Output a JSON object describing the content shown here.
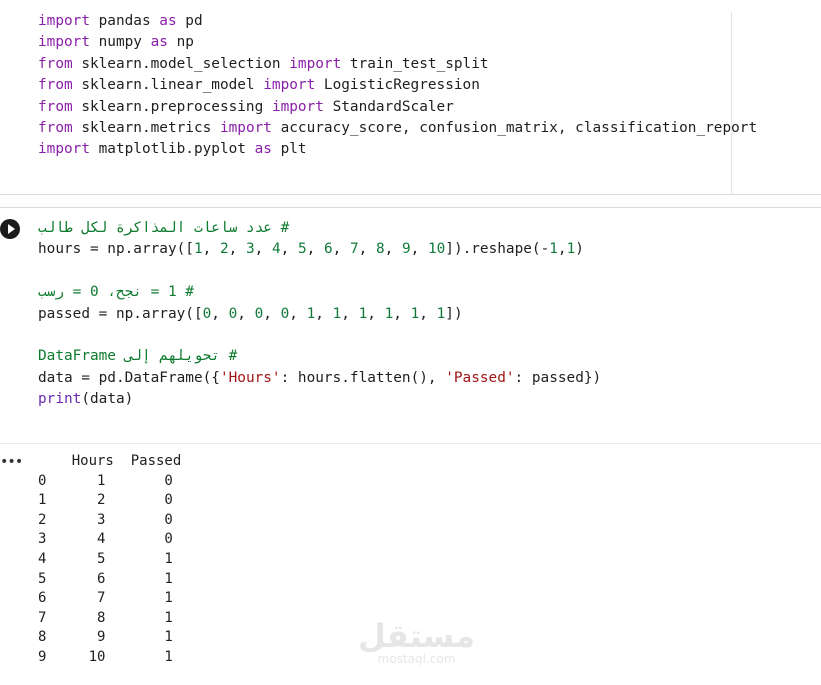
{
  "cell1": {
    "lines": [
      [
        [
          "kw",
          "import"
        ],
        [
          "plain",
          " pandas "
        ],
        [
          "kw",
          "as"
        ],
        [
          "plain",
          " pd"
        ]
      ],
      [
        [
          "kw",
          "import"
        ],
        [
          "plain",
          " numpy "
        ],
        [
          "kw",
          "as"
        ],
        [
          "plain",
          " np"
        ]
      ],
      [
        [
          "kw",
          "from"
        ],
        [
          "plain",
          " sklearn.model_selection "
        ],
        [
          "kw",
          "import"
        ],
        [
          "plain",
          " train_test_split"
        ]
      ],
      [
        [
          "kw",
          "from"
        ],
        [
          "plain",
          " sklearn.linear_model "
        ],
        [
          "kw",
          "import"
        ],
        [
          "plain",
          " LogisticRegression"
        ]
      ],
      [
        [
          "kw",
          "from"
        ],
        [
          "plain",
          " sklearn.preprocessing "
        ],
        [
          "kw",
          "import"
        ],
        [
          "plain",
          " StandardScaler"
        ]
      ],
      [
        [
          "kw",
          "from"
        ],
        [
          "plain",
          " sklearn.metrics "
        ],
        [
          "kw",
          "import"
        ],
        [
          "plain",
          " accuracy_score, confusion_matrix, classification_report"
        ]
      ],
      [
        [
          "kw",
          "import"
        ],
        [
          "plain",
          " matplotlib.pyplot "
        ],
        [
          "kw",
          "as"
        ],
        [
          "plain",
          " plt"
        ]
      ]
    ]
  },
  "cell2": {
    "lines": [
      [
        [
          "com",
          "# عدد ساعات المذاكرة لكل طالب"
        ]
      ],
      [
        [
          "plain",
          "hours = np.array(["
        ],
        [
          "num",
          "1"
        ],
        [
          "plain",
          ", "
        ],
        [
          "num",
          "2"
        ],
        [
          "plain",
          ", "
        ],
        [
          "num",
          "3"
        ],
        [
          "plain",
          ", "
        ],
        [
          "num",
          "4"
        ],
        [
          "plain",
          ", "
        ],
        [
          "num",
          "5"
        ],
        [
          "plain",
          ", "
        ],
        [
          "num",
          "6"
        ],
        [
          "plain",
          ", "
        ],
        [
          "num",
          "7"
        ],
        [
          "plain",
          ", "
        ],
        [
          "num",
          "8"
        ],
        [
          "plain",
          ", "
        ],
        [
          "num",
          "9"
        ],
        [
          "plain",
          ", "
        ],
        [
          "num",
          "10"
        ],
        [
          "plain",
          "]).reshape(-"
        ],
        [
          "num",
          "1"
        ],
        [
          "plain",
          ","
        ],
        [
          "num",
          "1"
        ],
        [
          "plain",
          ")"
        ]
      ],
      [],
      [
        [
          "com",
          "# 1 = نجح، 0 = رسب"
        ]
      ],
      [
        [
          "plain",
          "passed = np.array(["
        ],
        [
          "num",
          "0"
        ],
        [
          "plain",
          ", "
        ],
        [
          "num",
          "0"
        ],
        [
          "plain",
          ", "
        ],
        [
          "num",
          "0"
        ],
        [
          "plain",
          ", "
        ],
        [
          "num",
          "0"
        ],
        [
          "plain",
          ", "
        ],
        [
          "num",
          "1"
        ],
        [
          "plain",
          ", "
        ],
        [
          "num",
          "1"
        ],
        [
          "plain",
          ", "
        ],
        [
          "num",
          "1"
        ],
        [
          "plain",
          ", "
        ],
        [
          "num",
          "1"
        ],
        [
          "plain",
          ", "
        ],
        [
          "num",
          "1"
        ],
        [
          "plain",
          ", "
        ],
        [
          "num",
          "1"
        ],
        [
          "plain",
          "])"
        ]
      ],
      [],
      [
        [
          "com",
          "# تحويلهم إلى DataFrame"
        ]
      ],
      [
        [
          "plain",
          "data = pd.DataFrame({"
        ],
        [
          "str",
          "'Hours'"
        ],
        [
          "plain",
          ": hours.flatten(), "
        ],
        [
          "str",
          "'Passed'"
        ],
        [
          "plain",
          ": passed})"
        ]
      ],
      [
        [
          "fn",
          "print"
        ],
        [
          "plain",
          "(data)"
        ]
      ]
    ]
  },
  "output": {
    "header": "    Hours  Passed",
    "rows": [
      "0      1       0",
      "1      2       0",
      "2      3       0",
      "3      4       0",
      "4      5       1",
      "5      6       1",
      "6      7       1",
      "7      8       1",
      "8      9       1",
      "9     10       1"
    ]
  },
  "ui": {
    "output_menu": "•••",
    "watermark_ar": "مستقل",
    "watermark_en": "mostaql.com"
  }
}
